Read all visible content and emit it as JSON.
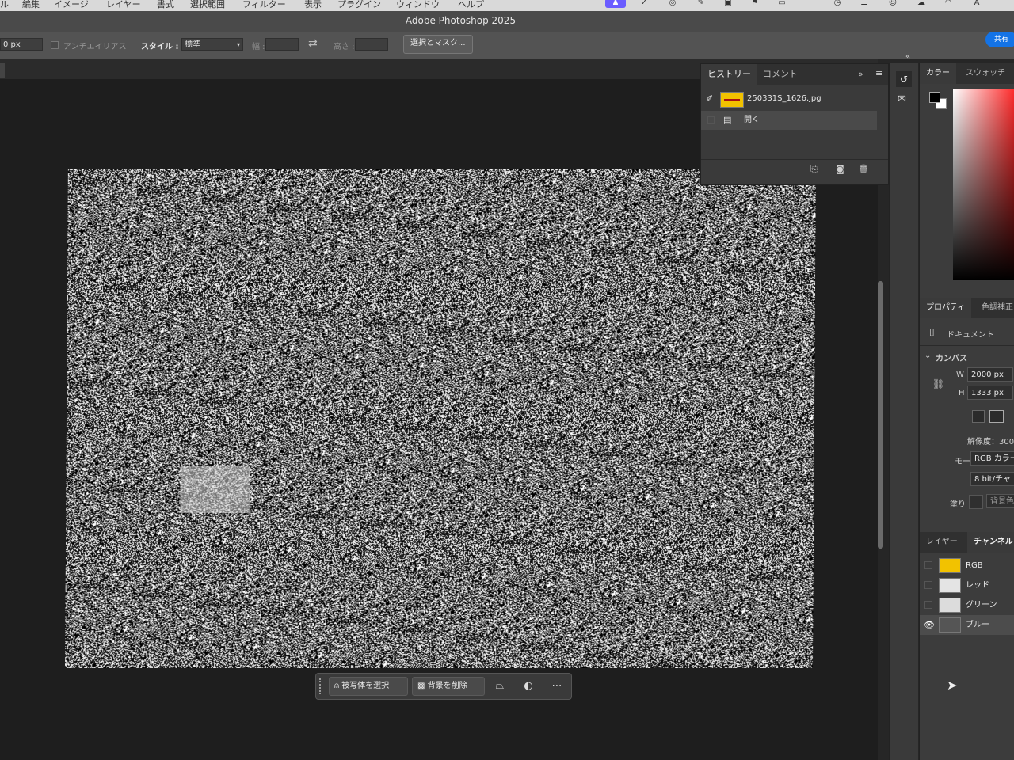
{
  "menubar": {
    "items": [
      "ル",
      "編集",
      "イメージ",
      "レイヤー",
      "書式",
      "選択範囲",
      "フィルター",
      "表示",
      "プラグイン",
      "ウィンドウ",
      "ヘルプ"
    ],
    "status_icons": [
      "user-icon",
      "check-circle-icon",
      "creative-cloud-icon",
      "pen-icon",
      "abp-icon",
      "flag-icon",
      "window-icon",
      "clock-icon",
      "menu-icon",
      "face-icon",
      "cloud-icon",
      "wifi-icon",
      "input-a-icon"
    ]
  },
  "app": {
    "title": "Adobe Photoshop 2025",
    "share_label": "共有"
  },
  "options": {
    "feather_value": "0 px",
    "antialias_label": "アンチエイリアス",
    "style_label": "スタイル :",
    "style_value": "標準",
    "width_label": "幅 :",
    "height_label": "高さ :",
    "select_mask_label": "選択とマスク..."
  },
  "history": {
    "tabs": [
      "ヒストリー",
      "コメント"
    ],
    "snapshot_name": "250331S_1626.jpg",
    "steps": [
      "開く"
    ]
  },
  "color_panel": {
    "tabs": [
      "カラー",
      "スウォッチ"
    ]
  },
  "properties": {
    "tabs": [
      "プロパティ",
      "色調補正"
    ],
    "doc_label": "ドキュメント",
    "canvas_section": "カンバス",
    "w_label": "W",
    "w_value": "2000 px",
    "h_label": "H",
    "h_value": "1333 px",
    "resolution": "解像度：300",
    "mode_label": "モード",
    "mode_value": "RGB カラー",
    "bit_value": "8 bit/チャ",
    "fill_label": "塗り",
    "bg_label": "背景色"
  },
  "layers": {
    "tabs": [
      "レイヤー",
      "チャンネル"
    ],
    "channels": [
      {
        "name": "RGB",
        "visible": false
      },
      {
        "name": "レッド",
        "visible": false
      },
      {
        "name": "グリーン",
        "visible": false
      },
      {
        "name": "ブルー",
        "visible": true
      }
    ]
  },
  "taskbar": {
    "select_subject": "被写体を選択",
    "remove_bg": "背景を削除"
  },
  "colors": {
    "accent": "#1473e6",
    "menu_highlight": "#6a5cff",
    "panel_bg": "#3a3a3a"
  }
}
